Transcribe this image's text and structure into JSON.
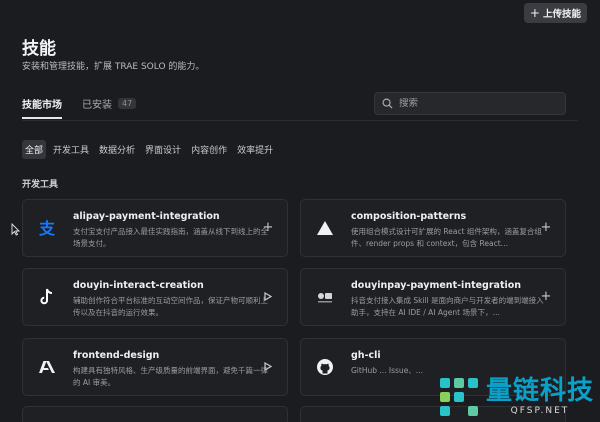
{
  "header": {
    "upload_label": "上传技能",
    "title": "技能",
    "subtitle": "安装和管理技能，扩展 TRAE SOLO 的能力。"
  },
  "tabs": [
    {
      "label": "技能市场",
      "active": true
    },
    {
      "label": "已安装",
      "count": "47",
      "active": false
    }
  ],
  "search": {
    "placeholder": "搜索"
  },
  "filters": [
    {
      "label": "全部",
      "active": true
    },
    {
      "label": "开发工具"
    },
    {
      "label": "数据分析"
    },
    {
      "label": "界面设计"
    },
    {
      "label": "内容创作"
    },
    {
      "label": "效率提升"
    }
  ],
  "section": {
    "title": "开发工具"
  },
  "cards": [
    {
      "name": "alipay-payment-integration",
      "desc": "支付宝支付产品接入最佳实践指南，涵盖从线下到线上的全场景支付。",
      "icon": "alipay-icon",
      "action": "install"
    },
    {
      "name": "composition-patterns",
      "desc": "使用组合模式设计可扩展的 React 组件架构，涵盖复合组件、render props 和 context，包含 React…",
      "icon": "triangle-icon",
      "action": "install"
    },
    {
      "name": "douyin-interact-creation",
      "desc": "辅助创作符合平台标准的互动空间作品，保证产物可顺利上传以及在抖音的运行效果。",
      "icon": "tiktok-icon",
      "action": "open"
    },
    {
      "name": "douyinpay-payment-integration",
      "desc": "抖音支付接入集成 Skill 是面向商户与开发者的端到端接入助手，支持在 AI IDE / AI Agent 场景下，…",
      "icon": "douyinpay-icon",
      "action": "install"
    },
    {
      "name": "frontend-design",
      "desc": "构建具有独特风格、生产级质量的前端界面，避免千篇一律的 AI 审美。",
      "icon": "anthropic-icon",
      "action": "open"
    },
    {
      "name": "gh-cli",
      "desc": "GitHub ... Issue、...",
      "icon": "github-icon",
      "action": "install"
    }
  ],
  "watermark": {
    "cn": "量链科技",
    "url": "QFSP.NET"
  },
  "colors": {
    "background": "#1b1c1f",
    "card": "#1f2024",
    "alipay": "#1677ff",
    "watermark": "#0aa0c8"
  }
}
